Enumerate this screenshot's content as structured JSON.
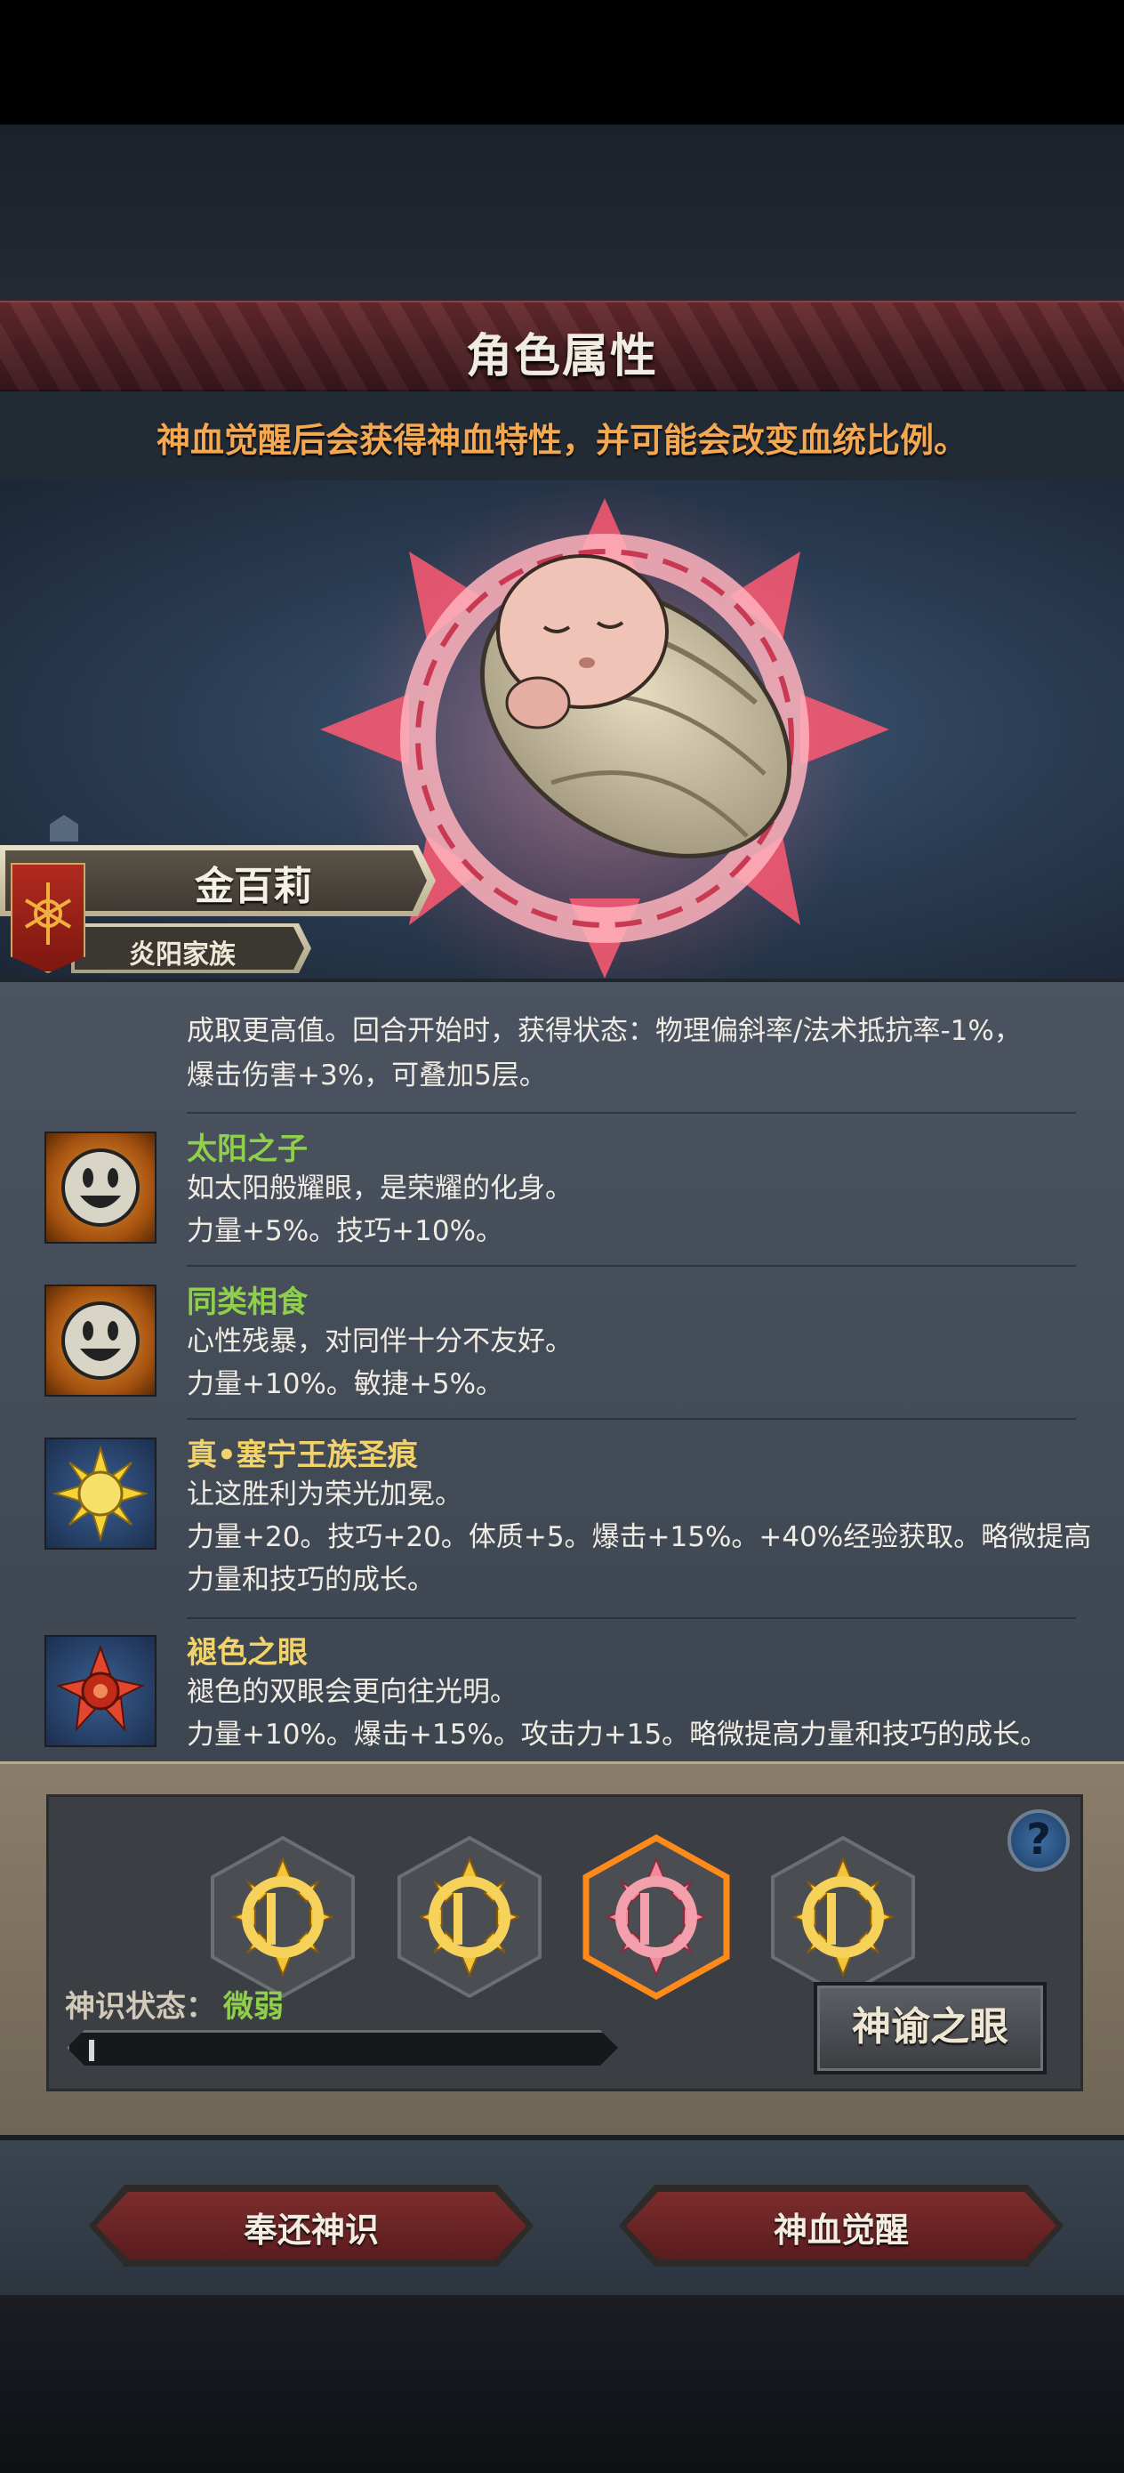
{
  "header": {
    "title": "角色属性",
    "notice": "神血觉醒后会获得神血特性，并可能会改变血统比例。"
  },
  "character": {
    "name": "金百莉",
    "family": "炎阳家族"
  },
  "traits_clipped_text": {
    "line1": "成取更高值。回合开始时，获得状态：物理偏斜率/法术抵抗率-1%，",
    "line2": "爆击伤害+3%，可叠加5层。"
  },
  "traits": [
    {
      "title": "太阳之子",
      "desc": "如太阳般耀眼，是荣耀的化身。",
      "effect": "力量+5%。技巧+10%。",
      "icon": "smiley-face-icon",
      "title_color": "#8fd04a"
    },
    {
      "title": "同类相食",
      "desc": "心性残暴，对同伴十分不友好。",
      "effect": "力量+10%。敏捷+5%。",
      "icon": "smiley-face-icon",
      "title_color": "#8fd04a"
    },
    {
      "title": "真•塞宁王族圣痕",
      "desc": "让这胜利为荣光加冕。",
      "effect": "力量+20。技巧+20。体质+5。爆击+15%。+40%经验获取。略微提高力量和技巧的成长。",
      "icon": "golden-sun-icon",
      "title_color": "#f1d36a"
    },
    {
      "title": "褪色之眼",
      "desc": "褪色的双眼会更向往光明。",
      "effect": "力量+10%。爆击+15%。攻击力+15。略微提高力量和技巧的成长。",
      "icon": "red-flower-icon",
      "title_color": "#f1d36a"
    }
  ],
  "awakening": {
    "status_label": "神识状态：",
    "status_value": "微弱",
    "progress": 0.01,
    "oracle_button": "神谕之眼",
    "help": "?",
    "slots": [
      "gold",
      "gold",
      "red",
      "gold"
    ],
    "selected_slot": 2
  },
  "actions": {
    "return_button": "奉还神识",
    "awaken_button": "神血觉醒"
  },
  "colors": {
    "accent_red": "#6b2c30",
    "notice_orange": "#f4a852",
    "status_green": "#8fd04a",
    "selected_orange": "#ff8a1a"
  }
}
